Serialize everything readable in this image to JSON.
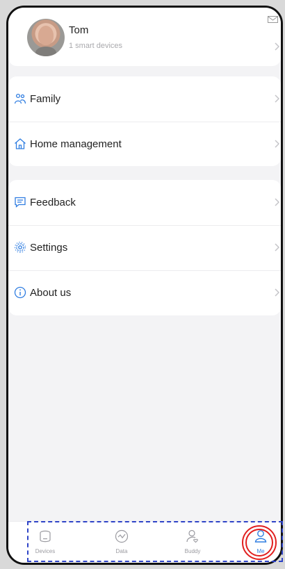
{
  "profile": {
    "name": "Tom",
    "device_count_text": "1 smart devices",
    "avatar_icon": "user-photo",
    "mail_icon": "mail-icon"
  },
  "menu": {
    "group1": [
      {
        "label": "Family",
        "icon": "family-icon"
      },
      {
        "label": "Home management",
        "icon": "home-icon"
      }
    ],
    "group2": [
      {
        "label": "Feedback",
        "icon": "feedback-icon"
      },
      {
        "label": "Settings",
        "icon": "settings-icon"
      },
      {
        "label": "About us",
        "icon": "info-icon"
      }
    ]
  },
  "tabs": [
    {
      "label": "Devices",
      "icon": "devices-icon",
      "active": false
    },
    {
      "label": "Data",
      "icon": "data-icon",
      "active": false
    },
    {
      "label": "Buddy",
      "icon": "buddy-icon",
      "active": false
    },
    {
      "label": "Me",
      "icon": "me-icon",
      "active": true
    }
  ],
  "colors": {
    "accent": "#2f7de1",
    "annotation_red": "#e11f1f",
    "annotation_blue": "#2e43c7",
    "background": "#f3f3f5"
  }
}
